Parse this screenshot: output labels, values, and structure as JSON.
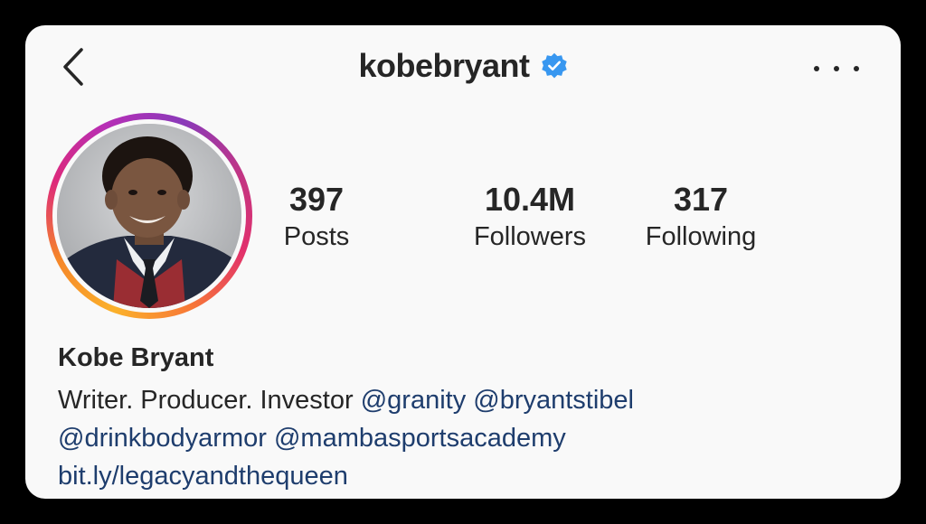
{
  "header": {
    "username": "kobebryant",
    "verified": true,
    "back_icon": "chevron-left-icon",
    "more_icon": "more-horizontal-icon"
  },
  "profile": {
    "avatar_icon": "profile-photo",
    "story_ring_colors": [
      "#fbb12b",
      "#f58529",
      "#dd2a7b",
      "#8a3ab9"
    ]
  },
  "stats": [
    {
      "value": "397",
      "label": "Posts"
    },
    {
      "value": "10.4M",
      "label": "Followers"
    },
    {
      "value": "317",
      "label": "Following"
    }
  ],
  "bio": {
    "full_name": "Kobe Bryant",
    "text": "Writer. Producer. Investor",
    "mentions": [
      "@granity",
      "@bryantstibel",
      "@drinkbodyarmor",
      "@mambasportsacademy"
    ],
    "link": "bit.ly/legacyandthequeen"
  },
  "colors": {
    "text": "#262626",
    "link": "#1e3d6d",
    "verified": "#3897f0",
    "background": "#f9f9f9"
  }
}
